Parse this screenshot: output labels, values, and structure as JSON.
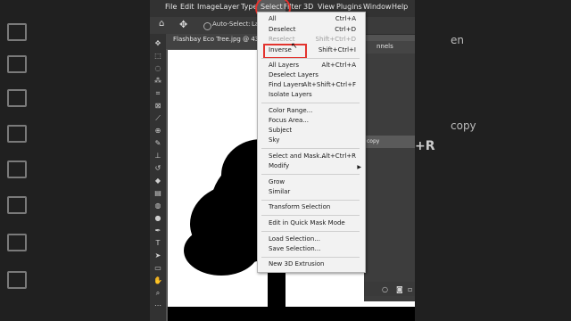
{
  "menubar": {
    "items": [
      "File",
      "Edit",
      "Image",
      "Layer",
      "Type",
      "Select",
      "Filter",
      "3D",
      "View",
      "Plugins",
      "Window",
      "Help"
    ]
  },
  "options_bar": {
    "auto_select_label": "Auto-Select:",
    "layer_label": "La"
  },
  "document_tab": {
    "title": "Flashbay Eco Tree.jpg @ 43.8..."
  },
  "layers_panel": {
    "tab_label": "nnels",
    "layer_item": "copy"
  },
  "background_ghost": {
    "text1": "en",
    "text2": "copy",
    "text3": "+R"
  },
  "select_menu": {
    "items": [
      {
        "label": "All",
        "shortcut": "Ctrl+A"
      },
      {
        "label": "Deselect",
        "shortcut": "Ctrl+D"
      },
      {
        "label": "Reselect",
        "shortcut": "Shift+Ctrl+D",
        "disabled": true
      },
      {
        "label": "Inverse",
        "shortcut": "Shift+Ctrl+I"
      },
      {
        "label": "All Layers",
        "shortcut": "Alt+Ctrl+A"
      },
      {
        "label": "Deselect Layers",
        "shortcut": ""
      },
      {
        "label": "Find Layers",
        "shortcut": "Alt+Shift+Ctrl+F"
      },
      {
        "label": "Isolate Layers",
        "shortcut": ""
      },
      {
        "label": "Color Range...",
        "shortcut": ""
      },
      {
        "label": "Focus Area...",
        "shortcut": ""
      },
      {
        "label": "Subject",
        "shortcut": ""
      },
      {
        "label": "Sky",
        "shortcut": ""
      },
      {
        "label": "Select and Mask...",
        "shortcut": "Alt+Ctrl+R"
      },
      {
        "label": "Modify",
        "shortcut": ""
      },
      {
        "label": "Grow",
        "shortcut": ""
      },
      {
        "label": "Similar",
        "shortcut": ""
      },
      {
        "label": "Transform Selection",
        "shortcut": ""
      },
      {
        "label": "Edit in Quick Mask Mode",
        "shortcut": ""
      },
      {
        "label": "Load Selection...",
        "shortcut": ""
      },
      {
        "label": "Save Selection...",
        "shortcut": ""
      },
      {
        "label": "New 3D Extrusion",
        "shortcut": ""
      }
    ]
  },
  "colors": {
    "highlight_red": "#e3342f",
    "menu_bg": "#f2f2f2",
    "app_bar": "#323232"
  }
}
